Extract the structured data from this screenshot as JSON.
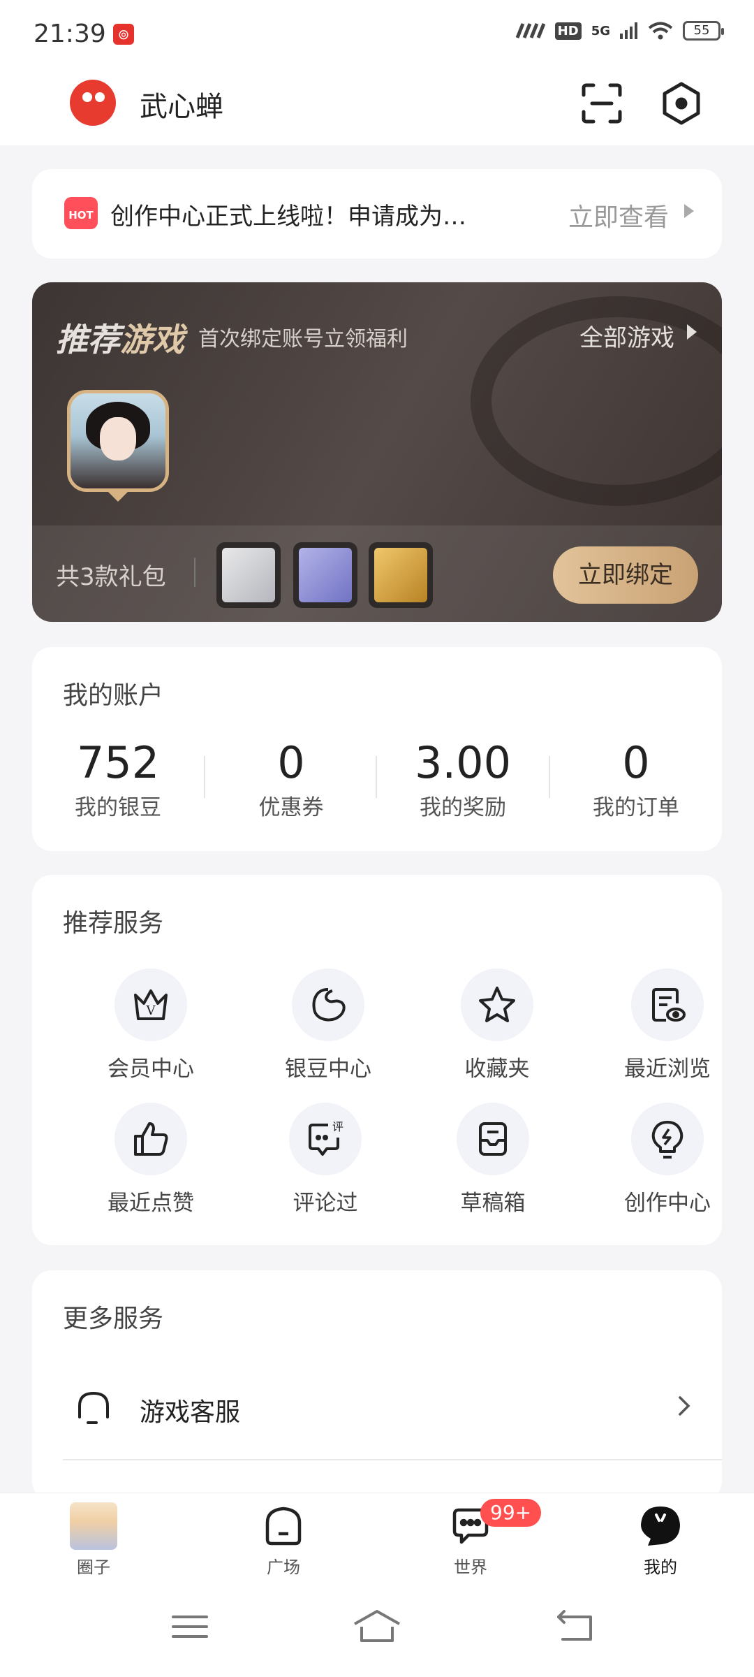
{
  "status_bar": {
    "time": "21:39",
    "app_icon": "netease-music-icon",
    "network": "5G",
    "hd": "HD",
    "battery": "55"
  },
  "header": {
    "username": "武心蝉"
  },
  "notice": {
    "badge": "HOT",
    "text": "创作中心正式上线啦！申请成为…",
    "link_label": "立即查看"
  },
  "game_banner": {
    "title_part1": "推荐",
    "title_part2": "游戏",
    "subtitle": "首次绑定账号立领福利",
    "all_label": "全部游戏",
    "gift_count": "共3款礼包",
    "bind_label": "立即绑定"
  },
  "account": {
    "title": "我的账户",
    "stats": [
      {
        "value": "752",
        "label": "我的银豆"
      },
      {
        "value": "0",
        "label": "优惠券"
      },
      {
        "value": "3.00",
        "label": "我的奖励"
      },
      {
        "value": "0",
        "label": "我的订单"
      }
    ]
  },
  "services": {
    "title": "推荐服务",
    "items": [
      {
        "label": "会员中心",
        "icon": "crown-icon"
      },
      {
        "label": "银豆中心",
        "icon": "bean-icon"
      },
      {
        "label": "收藏夹",
        "icon": "star-icon"
      },
      {
        "label": "最近浏览",
        "icon": "history-icon"
      },
      {
        "label": "最近点赞",
        "icon": "thumbs-up-icon"
      },
      {
        "label": "评论过",
        "icon": "comment-icon"
      },
      {
        "label": "草稿箱",
        "icon": "draft-box-icon"
      },
      {
        "label": "创作中心",
        "icon": "bulb-icon"
      }
    ],
    "comment_badge": "评"
  },
  "more_services": {
    "title": "更多服务",
    "items": [
      {
        "label": "游戏客服",
        "icon": "headset-icon"
      }
    ]
  },
  "bottom_nav": {
    "items": [
      {
        "label": "圈子"
      },
      {
        "label": "广场"
      },
      {
        "label": "世界",
        "badge": "99+"
      },
      {
        "label": "我的"
      }
    ]
  },
  "colors": {
    "accent_gold": "#d7b283",
    "badge_red": "#ff4f4f",
    "hot_red": "#ff4f5a"
  }
}
